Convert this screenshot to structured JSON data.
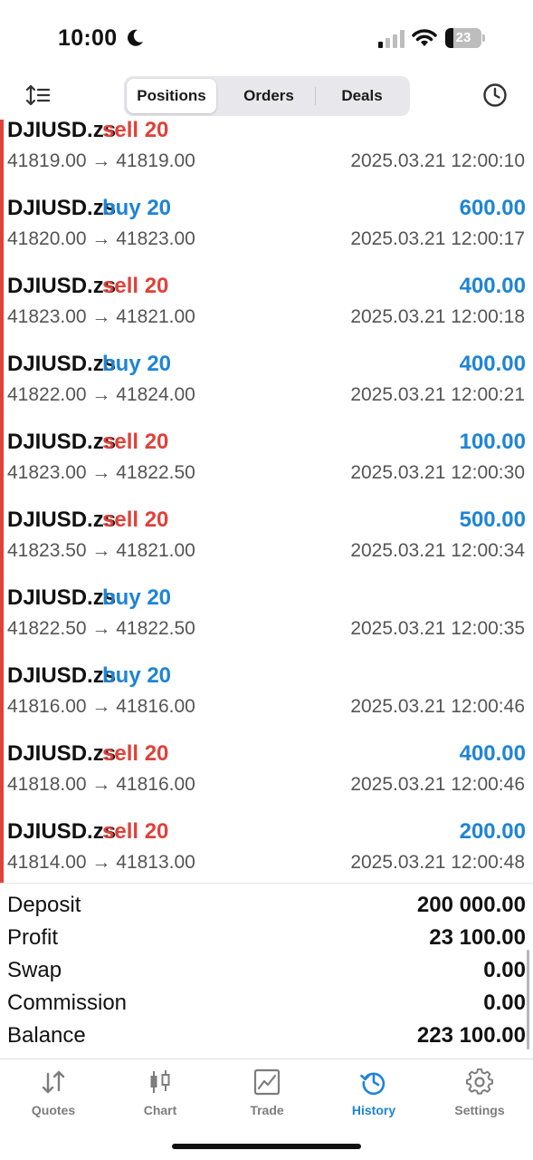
{
  "status_bar": {
    "time": "10:00",
    "battery_level": "23",
    "icons": [
      "moon-icon",
      "signal-icon",
      "wifi-icon",
      "battery-icon"
    ]
  },
  "toolbar": {
    "sort_icon": "sort-icon",
    "tabs": [
      {
        "label": "Positions",
        "selected": true
      },
      {
        "label": "Orders",
        "selected": false
      },
      {
        "label": "Deals",
        "selected": false
      }
    ],
    "history_icon": "clock-icon"
  },
  "deals": [
    {
      "symbol": "DJIUSD.zs",
      "type": "sell 20",
      "side": "sell",
      "profit": "",
      "prices": "41819.00 → 41819.00",
      "time": "2025.03.21 12:00:10"
    },
    {
      "symbol": "DJIUSD.zs",
      "type": "buy 20",
      "side": "buy",
      "profit": "600.00",
      "prices": "41820.00 → 41823.00",
      "time": "2025.03.21 12:00:17"
    },
    {
      "symbol": "DJIUSD.zs",
      "type": "sell 20",
      "side": "sell",
      "profit": "400.00",
      "prices": "41823.00 → 41821.00",
      "time": "2025.03.21 12:00:18"
    },
    {
      "symbol": "DJIUSD.zs",
      "type": "buy 20",
      "side": "buy",
      "profit": "400.00",
      "prices": "41822.00 → 41824.00",
      "time": "2025.03.21 12:00:21"
    },
    {
      "symbol": "DJIUSD.zs",
      "type": "sell 20",
      "side": "sell",
      "profit": "100.00",
      "prices": "41823.00 → 41822.50",
      "time": "2025.03.21 12:00:30"
    },
    {
      "symbol": "DJIUSD.zs",
      "type": "sell 20",
      "side": "sell",
      "profit": "500.00",
      "prices": "41823.50 → 41821.00",
      "time": "2025.03.21 12:00:34"
    },
    {
      "symbol": "DJIUSD.zs",
      "type": "buy 20",
      "side": "buy",
      "profit": "",
      "prices": "41822.50 → 41822.50",
      "time": "2025.03.21 12:00:35"
    },
    {
      "symbol": "DJIUSD.zs",
      "type": "buy 20",
      "side": "buy",
      "profit": "",
      "prices": "41816.00 → 41816.00",
      "time": "2025.03.21 12:00:46"
    },
    {
      "symbol": "DJIUSD.zs",
      "type": "sell 20",
      "side": "sell",
      "profit": "400.00",
      "prices": "41818.00 → 41816.00",
      "time": "2025.03.21 12:00:46"
    },
    {
      "symbol": "DJIUSD.zs",
      "type": "sell 20",
      "side": "sell",
      "profit": "200.00",
      "prices": "41814.00 → 41813.00",
      "time": "2025.03.21 12:00:48"
    }
  ],
  "summary": [
    {
      "label": "Deposit",
      "value": "200 000.00"
    },
    {
      "label": "Profit",
      "value": "23 100.00"
    },
    {
      "label": "Swap",
      "value": "0.00"
    },
    {
      "label": "Commission",
      "value": "0.00"
    },
    {
      "label": "Balance",
      "value": "223 100.00"
    }
  ],
  "tabbar": [
    {
      "label": "Quotes",
      "icon": "quotes-icon",
      "active": false
    },
    {
      "label": "Chart",
      "icon": "candlestick-chart-icon",
      "active": false
    },
    {
      "label": "Trade",
      "icon": "trade-chart-icon",
      "active": false
    },
    {
      "label": "History",
      "icon": "history-icon",
      "active": true
    },
    {
      "label": "Settings",
      "icon": "settings-gear-icon",
      "active": false
    }
  ],
  "colors": {
    "sell": "#e0413a",
    "buy": "#1e84d6",
    "profit": "#1e84d6",
    "accent": "#1e84d6",
    "inactive_tab": "#7d7d7d"
  }
}
